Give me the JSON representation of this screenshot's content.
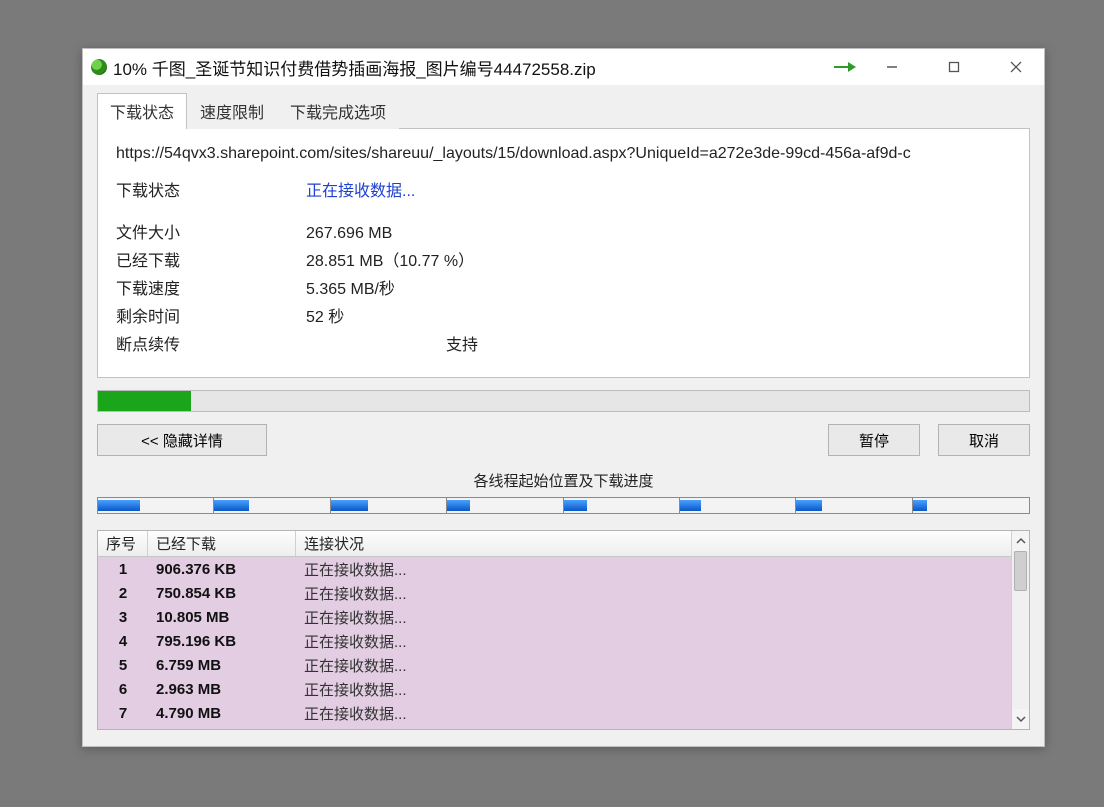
{
  "window_title": "10% 千图_圣诞节知识付费借势插画海报_图片编号44472558.zip",
  "tabs": {
    "download_status": "下载状态",
    "speed_limit": "速度限制",
    "on_complete": "下载完成选项"
  },
  "url": "https://54qvx3.sharepoint.com/sites/shareuu/_layouts/15/download.aspx?UniqueId=a272e3de-99cd-456a-af9d-c",
  "labels": {
    "status": "下载状态",
    "file_size": "文件大小",
    "downloaded": "已经下载",
    "speed": "下载速度",
    "time_left": "剩余时间",
    "resume": "断点续传"
  },
  "values": {
    "status": "正在接收数据...",
    "file_size": "267.696  MB",
    "downloaded": "28.851  MB（10.77 %）",
    "speed": "5.365  MB/秒",
    "time_left": "52 秒",
    "resume": "支持"
  },
  "progress_percent": 10,
  "buttons": {
    "hide_details": "<<  隐藏详情",
    "pause": "暂停",
    "cancel": "取消"
  },
  "chunk_section_label": "各线程起始位置及下载进度",
  "chunk_bar": {
    "segments": [
      {
        "width_pct": 12.5,
        "fill_pct": 36
      },
      {
        "width_pct": 12.5,
        "fill_pct": 30
      },
      {
        "width_pct": 12.5,
        "fill_pct": 32
      },
      {
        "width_pct": 12.5,
        "fill_pct": 20
      },
      {
        "width_pct": 12.5,
        "fill_pct": 20
      },
      {
        "width_pct": 12.5,
        "fill_pct": 18
      },
      {
        "width_pct": 12.5,
        "fill_pct": 22
      },
      {
        "width_pct": 12.5,
        "fill_pct": 12
      }
    ]
  },
  "table": {
    "headers": {
      "num": "序号",
      "downloaded": "已经下载",
      "status": "连接状况"
    },
    "rows": [
      {
        "num": "1",
        "downloaded": "906.376  KB",
        "status": "正在接收数据..."
      },
      {
        "num": "2",
        "downloaded": "750.854  KB",
        "status": "正在接收数据..."
      },
      {
        "num": "3",
        "downloaded": "10.805  MB",
        "status": "正在接收数据..."
      },
      {
        "num": "4",
        "downloaded": "795.196  KB",
        "status": "正在接收数据..."
      },
      {
        "num": "5",
        "downloaded": "6.759  MB",
        "status": "正在接收数据..."
      },
      {
        "num": "6",
        "downloaded": "2.963  MB",
        "status": "正在接收数据..."
      },
      {
        "num": "7",
        "downloaded": "4.790  MB",
        "status": "正在接收数据..."
      }
    ]
  }
}
